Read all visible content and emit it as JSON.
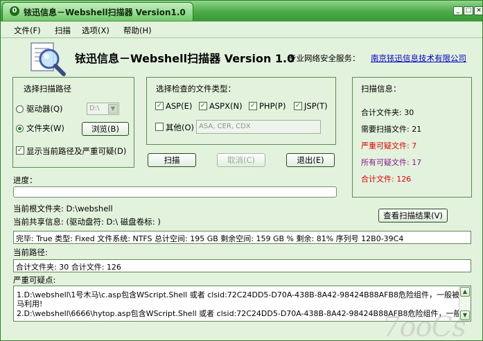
{
  "window": {
    "title": "铱迅信息－Webshell扫描器 Version1.0",
    "controls": [
      "_",
      "□",
      "×"
    ]
  },
  "menu": [
    {
      "label": "文件(F)"
    },
    {
      "label": "扫描"
    },
    {
      "label": "选项(X)"
    },
    {
      "label": "帮助(H)"
    }
  ],
  "header": {
    "title": "铱迅信息－Webshell扫描器 Version 1.0",
    "service_label": "专业网络安全服务：",
    "company_link": "南京铱迅信息技术有限公司",
    "logo_icon": "magnifier-document-icon"
  },
  "scan_path": {
    "group_title": "选择扫描路径",
    "drive_label": "驱动器(Q)",
    "drive_value": "D:\\",
    "folder_label": "文件夹(W)",
    "browse_button": "浏览(B)",
    "show_path_label": "显示当前路径及严重可疑(D)",
    "selected": "folder",
    "show_path_checked": true
  },
  "file_types": {
    "group_title": "选择检查的文件类型：",
    "types": [
      {
        "label": "ASP(E)",
        "checked": true
      },
      {
        "label": "ASPX(N)",
        "checked": true
      },
      {
        "label": "PHP(P)",
        "checked": true
      },
      {
        "label": "JSP(T)",
        "checked": true
      }
    ],
    "other_label": "其他(O)",
    "other_checked": false,
    "other_value": "ASA, CER, CDX"
  },
  "actions": {
    "scan": "扫描",
    "cancel": "取消(C)",
    "exit": "退出(E)"
  },
  "scan_info": {
    "title": "扫描信息：",
    "total_folders": "合计文件夹: 30",
    "files_to_scan": "需要扫描文件: 21",
    "severe_files": "严重可疑文件: 7",
    "suspicious_files": "所有可疑文件: 17",
    "total_files": "合计文件: 126",
    "view_results_button": "查看扫描结果(V)",
    "colors": {
      "normal": "#000000",
      "severe": "#e00000",
      "suspicious": "#8a1a8a",
      "total": "#e00000"
    }
  },
  "progress": {
    "label": "进度：",
    "value": 0
  },
  "status": {
    "root_folder": "当前根文件夹: D:\\webshell",
    "share_info": "当前共享信息: (驱动盘符: D:\\    磁盘卷标: )",
    "drive_details": "完毕: True    类型: Fixed    文件系统: NTFS    总计空间: 195 GB    剩余空间: 159 GB    % 剩余: 81%    序列号 12B0-39C4",
    "current_path_label": "当前路径:",
    "current_path_value": "合计文件夹: 30 合计文件: 126",
    "severe_label": "严重可疑点:",
    "severe_items": [
      "1.D:\\webshell\\1号木马\\c.asp包含WScript.Shell 或者 clsid:72C24DD5-D70A-438B-8A42-98424B88AFB8危险组件，一般被ASP木",
      "马利用!",
      "2.D:\\webshell\\6666\\hytop.asp包含WScript.Shell 或者 clsid:72C24DD5-D70A-438B-8A42-98424B88AFB8危险组件，一般被ASP木"
    ]
  },
  "watermark": "7ooCs"
}
